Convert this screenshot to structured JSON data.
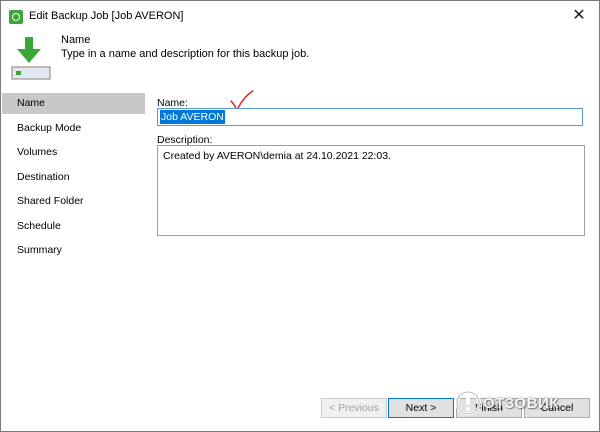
{
  "window": {
    "title": "Edit Backup Job [Job AVERON]"
  },
  "header": {
    "title": "Name",
    "subtitle": "Type in a name and description for this backup job."
  },
  "sidebar": {
    "items": [
      {
        "label": "Name",
        "active": true
      },
      {
        "label": "Backup Mode"
      },
      {
        "label": "Volumes"
      },
      {
        "label": "Destination"
      },
      {
        "label": "Shared Folder"
      },
      {
        "label": "Schedule"
      },
      {
        "label": "Summary"
      }
    ]
  },
  "form": {
    "name_label": "Name:",
    "name_value": "Job AVERON",
    "description_label": "Description:",
    "description_value": "Created by AVERON\\demia at 24.10.2021 22:03."
  },
  "footer": {
    "previous_label": "< Previous",
    "next_label": "Next >",
    "finish_label": "Finish",
    "cancel_label": "Cancel"
  },
  "watermark": {
    "text": "ОТЗОВИК"
  },
  "colors": {
    "accent": "#0078d7",
    "brand_green": "#3aa635",
    "active_item_bg": "#c8c8c8"
  }
}
